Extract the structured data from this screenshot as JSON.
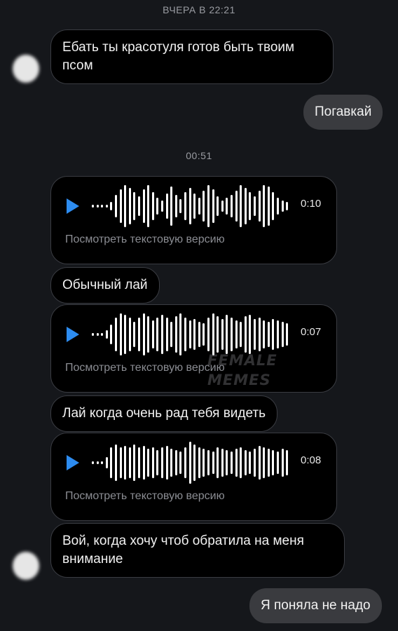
{
  "chat": {
    "timestamp_1": "ВЧЕРА В 22:21",
    "timestamp_2": "00:51",
    "messages": [
      {
        "text": "Ебать ты красотуля готов быть твоим псом"
      },
      {
        "text": "Погавкай"
      },
      {
        "duration": "0:10",
        "transcript_label": "Посмотреть текстовую версию"
      },
      {
        "text": "Обычный лай"
      },
      {
        "duration": "0:07",
        "transcript_label": "Посмотреть текстовую версию"
      },
      {
        "text": "Лай когда очень рад тебя видеть"
      },
      {
        "duration": "0:08",
        "transcript_label": "Посмотреть текстовую версию"
      },
      {
        "text": "Вой, когда хочу чтоб обратила на меня внимание"
      },
      {
        "text": "Я поняла не надо"
      }
    ]
  },
  "watermark": {
    "line1": "FEMALE",
    "line2": "MEMES"
  },
  "colors": {
    "background": "#15171b",
    "incoming_bubble": "#000000",
    "outgoing_bubble": "#3a3b3f",
    "play_accent": "#2d8cf0",
    "muted_text": "#8b8d93"
  },
  "icons": {
    "play": "play-icon",
    "avatar": "blurred-avatar"
  }
}
